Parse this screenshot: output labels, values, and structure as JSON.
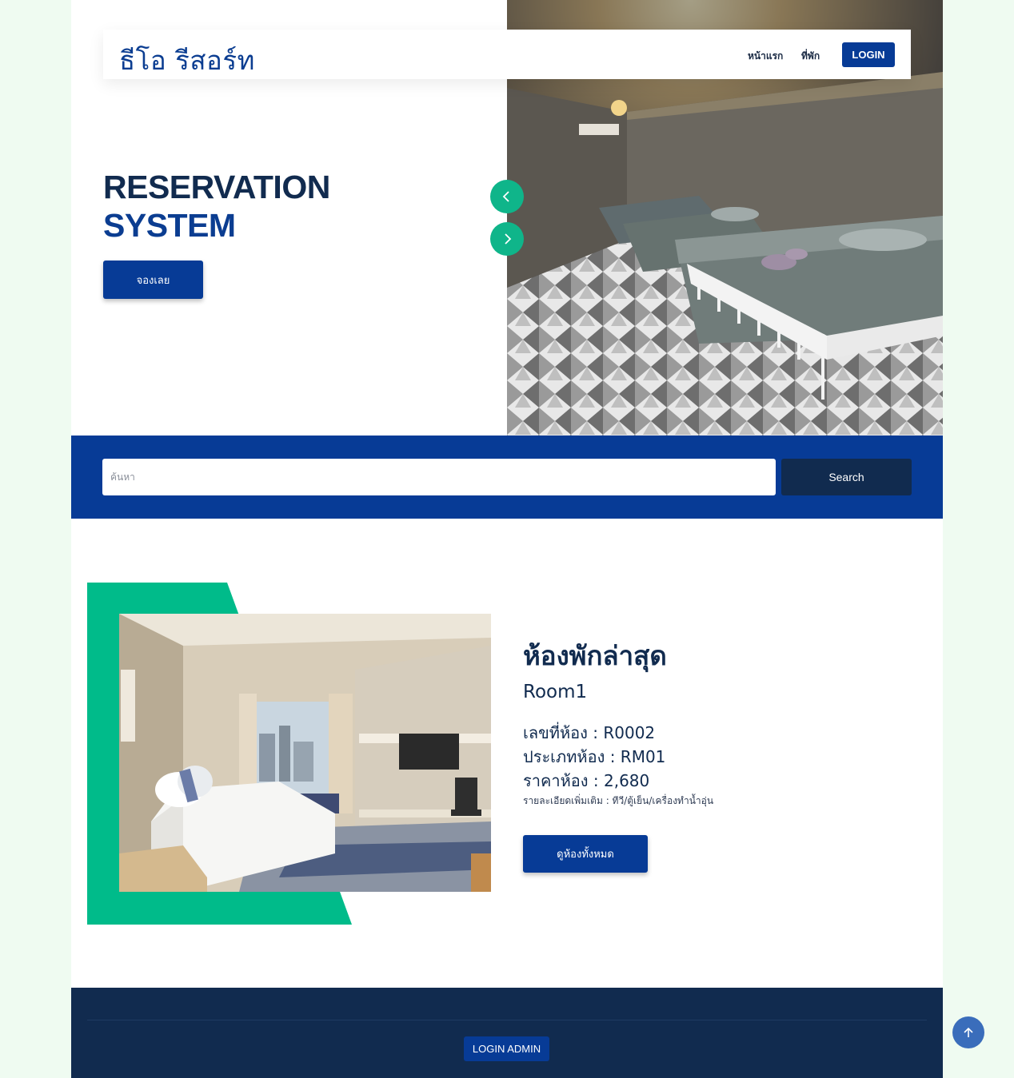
{
  "brand": {
    "name": "ธีโอ รีสอร์ท"
  },
  "nav": {
    "items": [
      {
        "label": "หน้าแรก"
      },
      {
        "label": "ที่พัก"
      }
    ],
    "login_label": "LOGIN"
  },
  "hero": {
    "title_line1": "RESERVATION",
    "title_line2": "SYSTEM",
    "book_label": "จองเลย",
    "prev_icon": "chevron-left-icon",
    "next_icon": "chevron-right-icon"
  },
  "search": {
    "placeholder": "ค้นหา",
    "value": "",
    "button_label": "Search"
  },
  "latest_room": {
    "heading": "ห้องพักล่าสุด",
    "name": "Room1",
    "number_line": "เลขที่ห้อง : R0002",
    "type_line": "ประเภทห้อง : RM01",
    "price_line": "ราคาห้อง : 2,680",
    "extra_line": "รายละเอียดเพิ่มเติม : ทีวี/ตู้เย็น/เครื่องทำน้ำอุ่น",
    "button_label": "ดูห้องทั้งหมด"
  },
  "footer": {
    "admin_label": "LOGIN ADMIN"
  },
  "colors": {
    "page_bg": "#effbf1",
    "primary": "#073b96",
    "navy": "#112b4f",
    "accent_green": "#00bb8a"
  },
  "back_to_top_icon": "arrow-up-icon"
}
